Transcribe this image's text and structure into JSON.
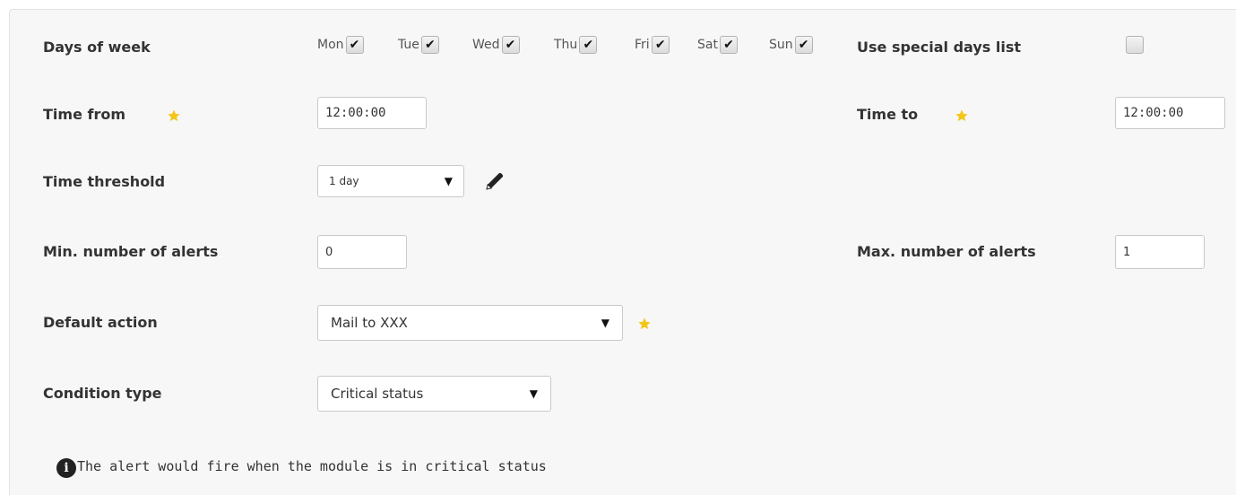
{
  "days_of_week": {
    "label": "Days of week",
    "days": [
      {
        "name": "Mon",
        "checked": true
      },
      {
        "name": "Tue",
        "checked": true
      },
      {
        "name": "Wed",
        "checked": true
      },
      {
        "name": "Thu",
        "checked": true
      },
      {
        "name": "Fri",
        "checked": true
      },
      {
        "name": "Sat",
        "checked": true
      },
      {
        "name": "Sun",
        "checked": true
      }
    ]
  },
  "special_days": {
    "label": "Use special days list",
    "checked": false
  },
  "time_from": {
    "label": "Time from",
    "value": "12:00:00"
  },
  "time_to": {
    "label": "Time to",
    "value": "12:00:00"
  },
  "time_threshold": {
    "label": "Time threshold",
    "value": "1 day"
  },
  "min_alerts": {
    "label": "Min. number of alerts",
    "value": "0"
  },
  "max_alerts": {
    "label": "Max. number of alerts",
    "value": "1"
  },
  "default_action": {
    "label": "Default action",
    "value": "Mail to XXX"
  },
  "condition_type": {
    "label": "Condition type",
    "value": "Critical status"
  },
  "info": {
    "icon": "i",
    "text": "The alert would fire when the module is in critical status"
  },
  "icons": {
    "required": "star-icon",
    "edit": "pencil-icon",
    "dropdown": "▼"
  },
  "colors": {
    "star": "#f5c518",
    "panel_bg": "#f7f7f7"
  },
  "glyphs": {
    "check": "✔"
  }
}
